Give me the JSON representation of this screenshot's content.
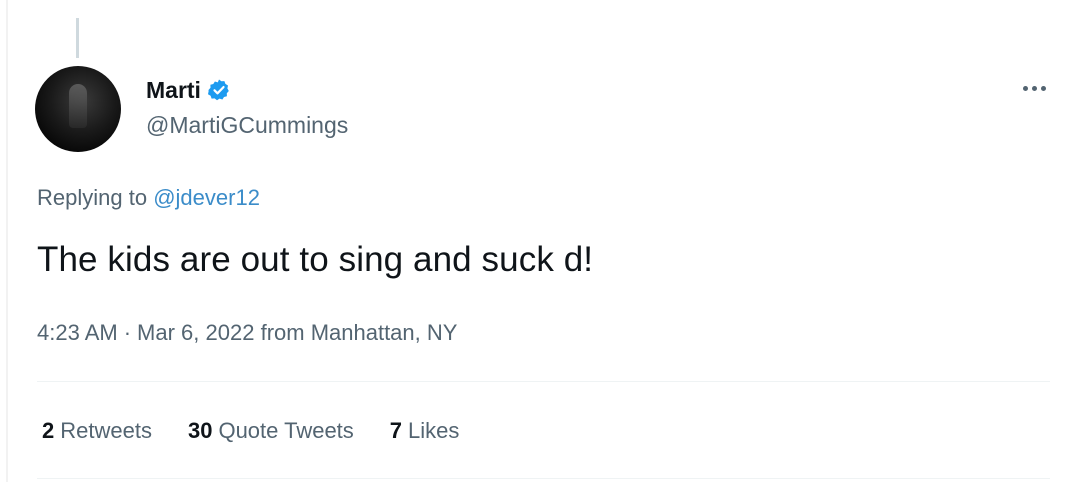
{
  "author": {
    "display_name": "Marti",
    "handle": "@MartiGCummings",
    "verified": true,
    "verified_color": "#1d9bf0"
  },
  "reply": {
    "prefix": "Replying to",
    "to_handle": "@jdever12"
  },
  "tweet": {
    "text": "The kids are out to sing and suck d!"
  },
  "meta": {
    "time": "4:23 AM",
    "separator": "·",
    "date": "Mar 6, 2022",
    "location": "from Manhattan, NY"
  },
  "stats": [
    {
      "count": "2",
      "label": "Retweets"
    },
    {
      "count": "30",
      "label": "Quote Tweets"
    },
    {
      "count": "7",
      "label": "Likes"
    }
  ],
  "icons": {
    "more": "more-horizontal-icon",
    "verified": "verified-badge-icon"
  }
}
